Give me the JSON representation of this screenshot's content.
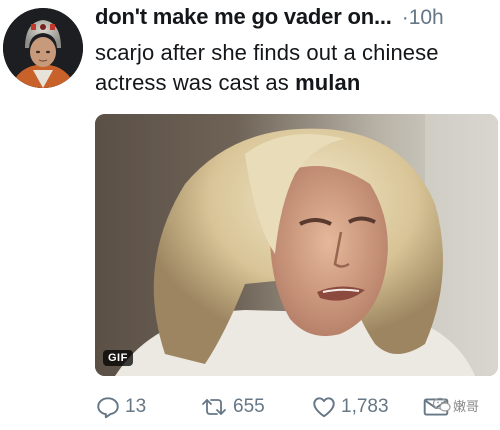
{
  "tweet": {
    "display_name": "don't make me go vader on...",
    "time": "·10h",
    "text_plain": "scarjo after she finds out a chinese actress was cast as ",
    "text_bold": "mulan"
  },
  "media": {
    "badge": "GIF"
  },
  "actions": {
    "reply_count": "13",
    "retweet_count": "655",
    "like_count": "1,783"
  },
  "watermark": {
    "text": "嫩哥"
  },
  "colors": {
    "text_primary": "#14171a",
    "text_secondary": "#657786",
    "background": "#ffffff"
  },
  "icons": [
    "avatar-pilot",
    "reply-icon",
    "retweet-icon",
    "like-icon",
    "mail-icon",
    "wechat-icon"
  ]
}
